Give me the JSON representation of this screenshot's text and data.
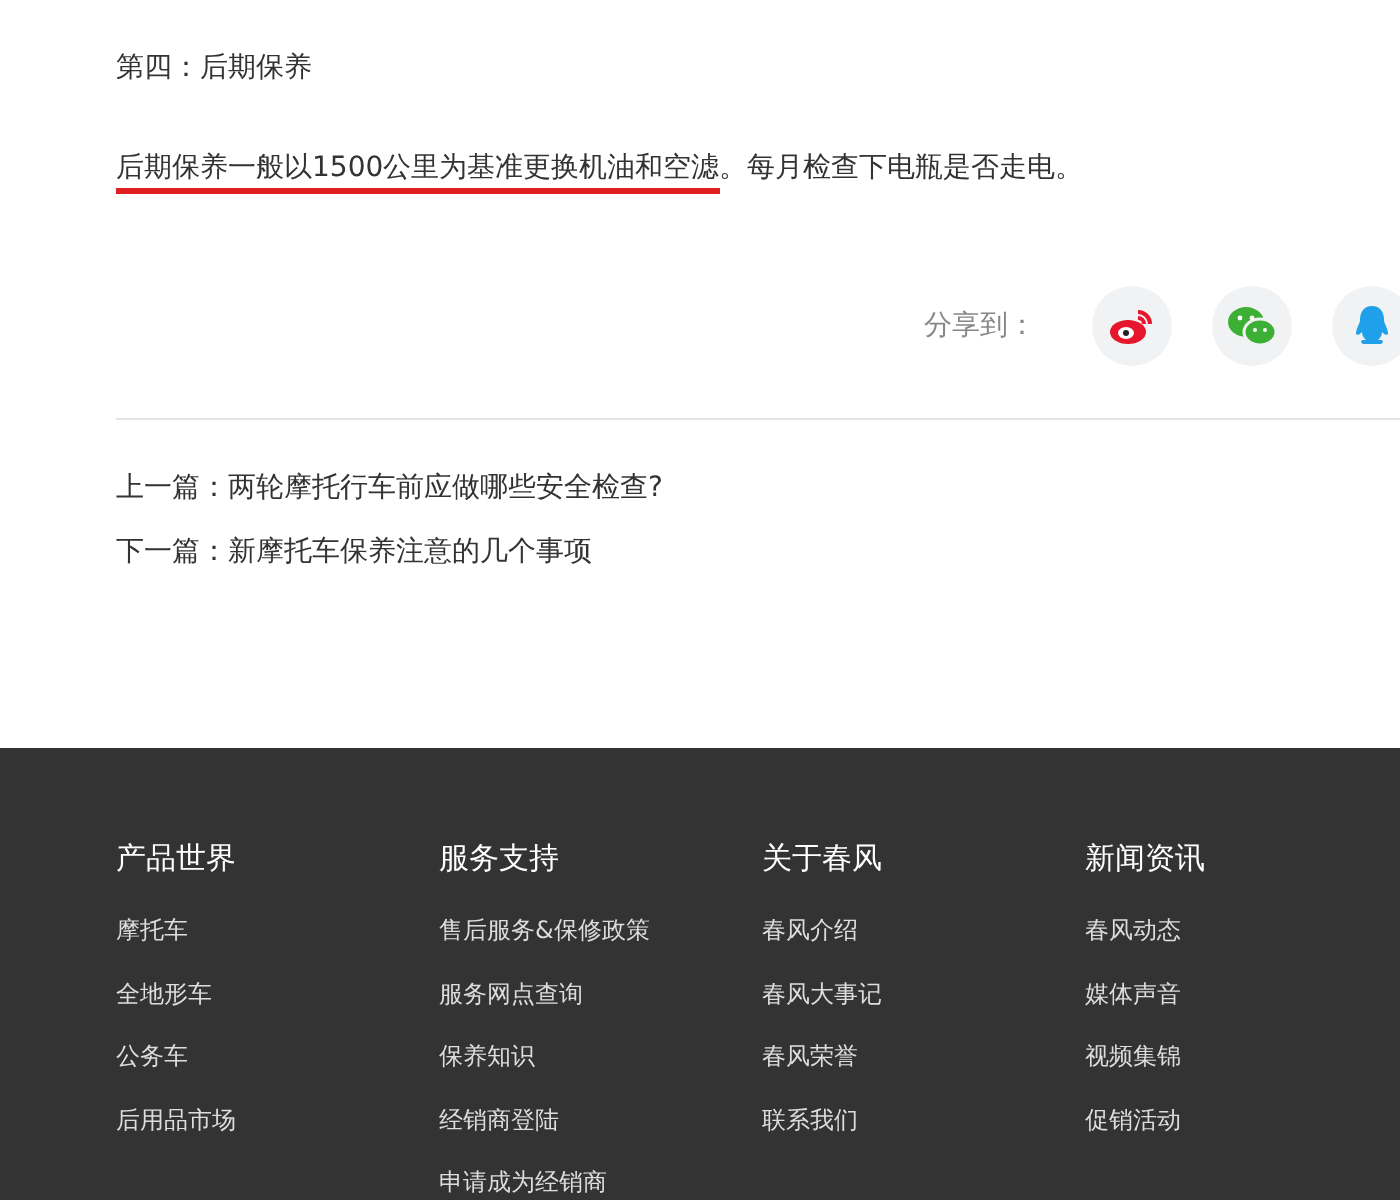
{
  "article": {
    "heading": "第四：后期保养",
    "paragraph": {
      "underlined": "后期保养一般以1500公里为基准更换机油和空滤",
      "rest": "。每月检查下电瓶是否走电。"
    }
  },
  "share": {
    "label": "分享到："
  },
  "navigation": [
    {
      "label": "上一篇：",
      "title": "两轮摩托行车前应做哪些安全检查?"
    },
    {
      "label": "下一篇：",
      "title": "新摩托车保养注意的几个事项"
    }
  ],
  "footer": {
    "columns": [
      {
        "heading": "产品世界",
        "links": [
          "摩托车",
          "全地形车",
          "公务车",
          "后用品市场"
        ]
      },
      {
        "heading": "服务支持",
        "links": [
          "售后服务&保修政策",
          "服务网点查询",
          "保养知识",
          "经销商登陆",
          "申请成为经销商"
        ]
      },
      {
        "heading": "关于春风",
        "links": [
          "春风介绍",
          "春风大事记",
          "春风荣誉",
          "联系我们"
        ]
      },
      {
        "heading": "新闻资讯",
        "links": [
          "春风动态",
          "媒体声音",
          "视频集锦",
          "促销活动"
        ]
      }
    ]
  }
}
